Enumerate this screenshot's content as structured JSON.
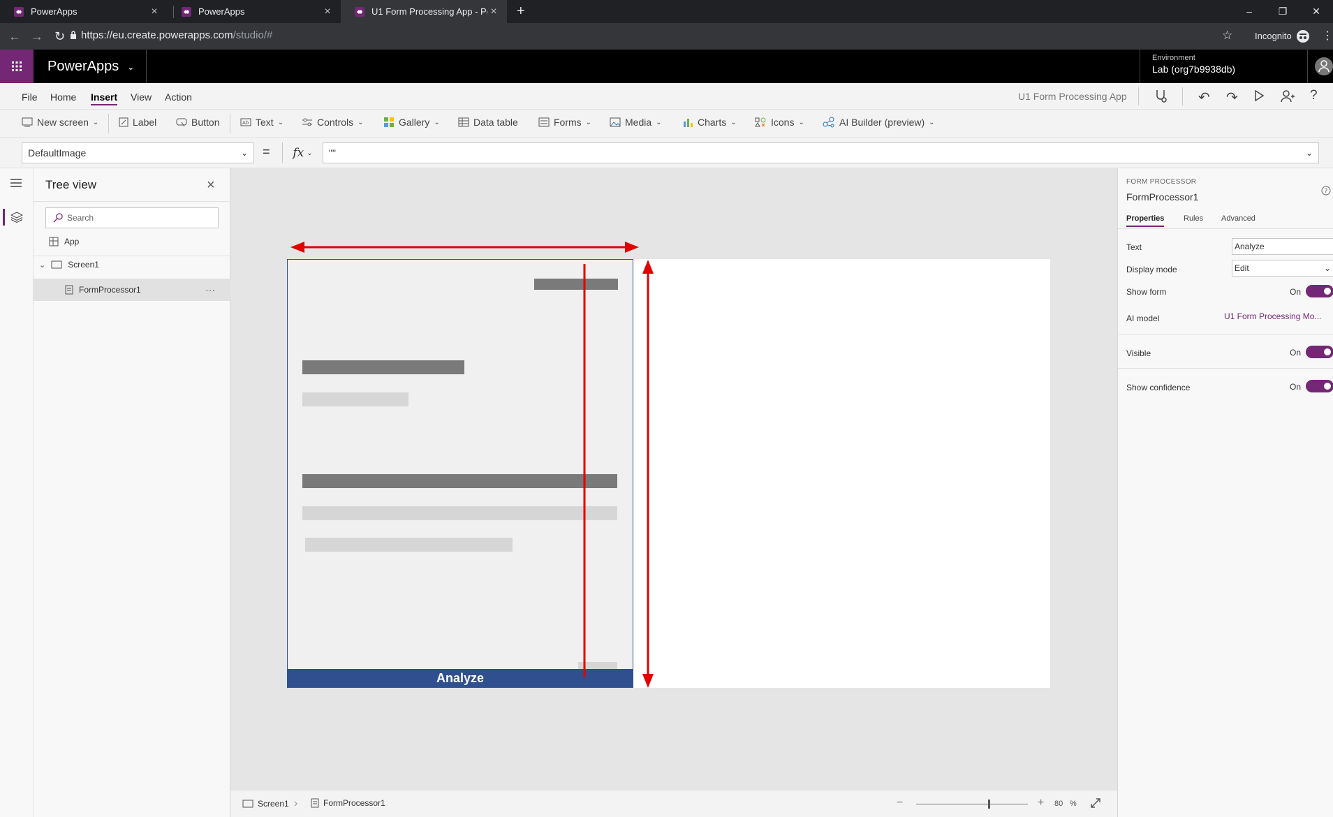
{
  "browser": {
    "tabs": [
      {
        "label": "PowerApps"
      },
      {
        "label": "PowerApps"
      },
      {
        "label": "U1 Form Processing App - Power"
      }
    ],
    "url_main": "https://eu.create.powerapps.com",
    "url_path": "/studio/#",
    "incognito_label": "Incognito"
  },
  "header": {
    "app_name": "PowerApps",
    "environment_label": "Environment",
    "environment_value": "Lab (org7b9938db)"
  },
  "menu": {
    "items": [
      "File",
      "Home",
      "Insert",
      "View",
      "Action"
    ],
    "active": "Insert",
    "app_title": "U1 Form Processing App"
  },
  "ribbon": {
    "new_screen": "New screen",
    "label": "Label",
    "button": "Button",
    "text": "Text",
    "controls": "Controls",
    "gallery": "Gallery",
    "data_table": "Data table",
    "forms": "Forms",
    "media": "Media",
    "charts": "Charts",
    "icons": "Icons",
    "ai_builder": "AI Builder (preview)"
  },
  "formula": {
    "property": "DefaultImage",
    "equals": "=",
    "fx": "fx",
    "value": "\"\""
  },
  "tree": {
    "title": "Tree view",
    "search_placeholder": "Search",
    "app_item": "App",
    "screen_item": "Screen1",
    "control_item": "FormProcessor1",
    "more": "···"
  },
  "canvas": {
    "analyze_label": "Analyze"
  },
  "status": {
    "screen": "Screen1",
    "control": "FormProcessor1",
    "zoom_value": "80",
    "zoom_unit": "%",
    "zoom_fraction": 0.65
  },
  "properties": {
    "type_label": "FORM PROCESSOR",
    "control_name": "FormProcessor1",
    "tabs": [
      "Properties",
      "Rules",
      "Advanced"
    ],
    "text_label": "Text",
    "text_value": "Analyze",
    "display_mode_label": "Display mode",
    "display_mode_value": "Edit",
    "show_form_label": "Show form",
    "show_form_value": "On",
    "ai_model_label": "AI model",
    "ai_model_value": "U1 Form Processing Mo...",
    "visible_label": "Visible",
    "visible_value": "On",
    "show_confidence_label": "Show confidence",
    "show_confidence_value": "On"
  },
  "colors": {
    "brand": "#742774",
    "analyze_button": "#2f4f8f",
    "annotation_arrow": "#e00000"
  }
}
